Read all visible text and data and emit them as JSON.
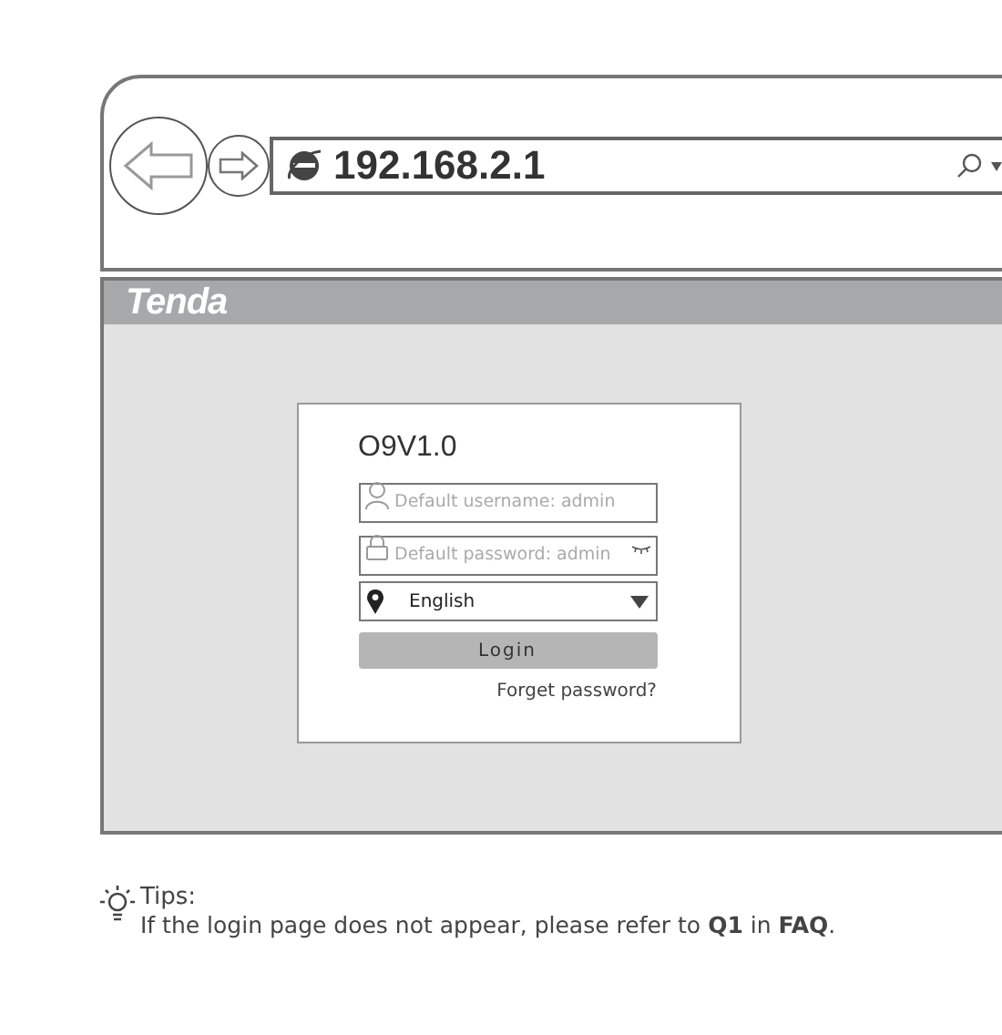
{
  "browser": {
    "address": "192.168.2.1"
  },
  "page": {
    "logo": "Tenda",
    "login": {
      "title": "O9V1.0",
      "username_placeholder": "Default username: admin",
      "password_placeholder": "Default password: admin",
      "language": "English",
      "login_button": "Login",
      "forgot_link": "Forget password?"
    }
  },
  "tips": {
    "title": "Tips:",
    "text": "If the login page does not appear, please refer to **Q1** in **FAQ**."
  }
}
